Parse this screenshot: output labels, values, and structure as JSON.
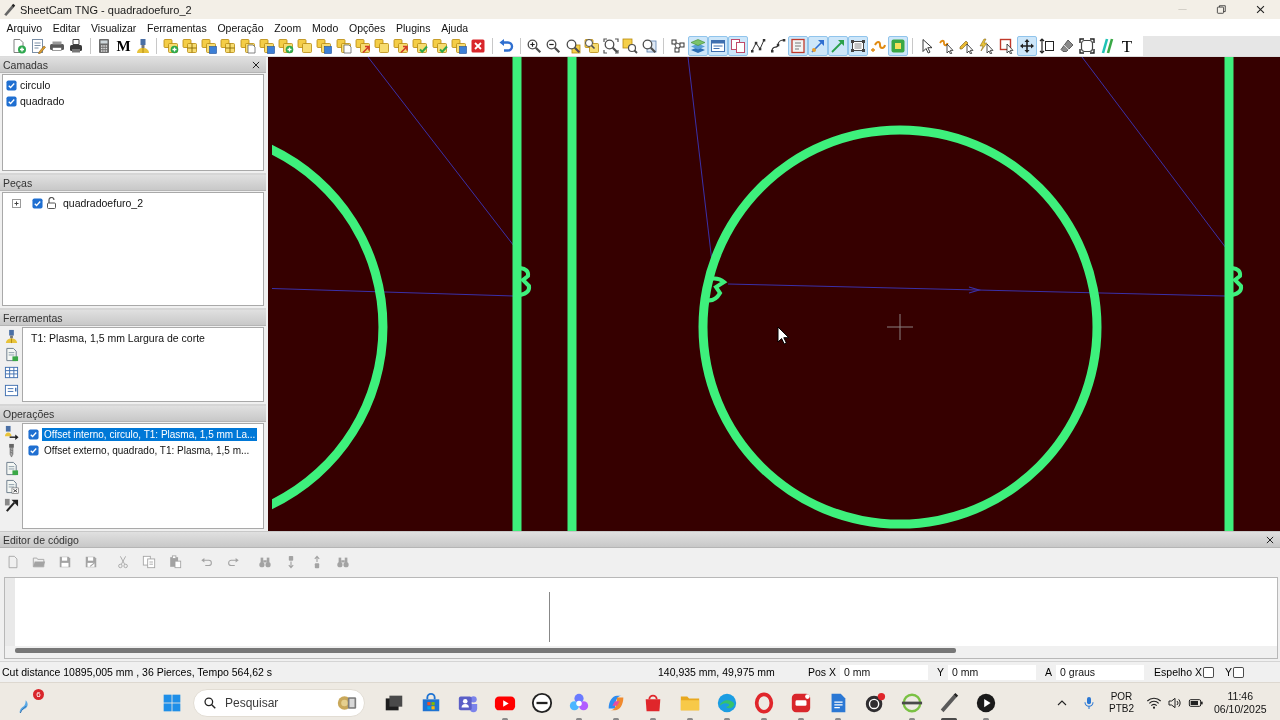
{
  "window": {
    "title": "SheetCam TNG - quadradoefuro_2"
  },
  "window_controls": [
    {
      "disabled": true
    },
    {
      "disabled": false
    },
    {
      "disabled": false
    }
  ],
  "menu": [
    "Arquivo",
    "Editar",
    "Visualizar",
    "Ferramentas",
    "Operação",
    "Zoom",
    "Modo",
    "Opções",
    "Plugins",
    "Ajuda"
  ],
  "toolbar": {
    "letter_button": "M",
    "view_toggles": [
      {
        "on": false
      },
      {
        "on": true
      },
      {
        "on": true
      },
      {
        "on": true
      },
      {
        "on": false
      },
      {
        "on": false
      },
      {
        "on": true
      },
      {
        "on": true
      },
      {
        "on": true
      },
      {
        "on": true
      },
      {
        "on": false
      },
      {
        "on": true
      }
    ],
    "mode_tools": [
      {
        "selected": false
      },
      {
        "selected": false
      },
      {
        "selected": false
      },
      {
        "selected": false
      },
      {
        "selected": false
      },
      {
        "selected": true
      },
      {
        "selected": false
      },
      {
        "selected": false
      },
      {
        "selected": false
      },
      {
        "selected": false
      },
      {
        "selected": false,
        "letter": "T"
      }
    ]
  },
  "panels": {
    "layers": {
      "title": "Camadas",
      "items": [
        {
          "label": "circulo",
          "checked": true
        },
        {
          "label": "quadrado",
          "checked": true
        }
      ]
    },
    "parts": {
      "title": "Peças",
      "items": [
        {
          "label": "quadradoefuro_2",
          "checked": true,
          "expanded": false,
          "locked": false
        }
      ]
    },
    "tools": {
      "title": "Ferramentas",
      "items": [
        {
          "label": "T1: Plasma, 1,5 mm Largura de corte"
        }
      ]
    },
    "operations": {
      "title": "Operações",
      "items": [
        {
          "label": "Offset interno, circulo, T1: Plasma, 1,5 mm La...",
          "checked": true,
          "selected": true
        },
        {
          "label": "Offset externo, quadrado, T1: Plasma, 1,5 m...",
          "checked": true,
          "selected": false
        }
      ]
    }
  },
  "code_editor": {
    "title": "Editor de código",
    "toolbar": [
      {
        "disabled": true
      },
      {
        "disabled": true
      },
      {
        "disabled": true
      },
      {
        "disabled": true
      },
      {
        "disabled": true
      },
      {
        "disabled": true
      },
      {
        "disabled": true
      },
      {
        "disabled": true
      },
      {
        "disabled": true
      },
      {
        "disabled": true
      },
      {
        "disabled": true
      },
      {
        "disabled": true
      },
      {
        "disabled": true
      }
    ]
  },
  "status_bar": {
    "summary": "Cut distance 10895,005 mm , 36 Pierces, Tempo 564,62 s",
    "cursor_position": "140,935 mm, 49,975 mm",
    "fields": [
      {
        "label": "Pos X",
        "value": "0 mm"
      },
      {
        "label": "Y",
        "value": "0 mm"
      },
      {
        "label": "A",
        "value": "0 graus"
      }
    ],
    "mirror": [
      {
        "label": "Espelho X",
        "checked": false
      },
      {
        "label": "Y",
        "checked": false
      }
    ]
  },
  "taskbar": {
    "widget_badge": "6",
    "search": {
      "placeholder": "Pesquisar"
    },
    "apps": [
      {
        "running": false,
        "active": false
      },
      {
        "running": false,
        "active": false
      },
      {
        "running": false,
        "active": false
      },
      {
        "running": true,
        "active": false
      },
      {
        "running": false,
        "active": false
      },
      {
        "running": true,
        "active": false
      },
      {
        "running": true,
        "active": false
      },
      {
        "running": true,
        "active": false
      },
      {
        "running": true,
        "active": false
      },
      {
        "running": true,
        "active": false
      },
      {
        "running": true,
        "active": false
      },
      {
        "running": true,
        "active": false
      },
      {
        "running": true,
        "active": false
      },
      {
        "running": false,
        "active": false
      },
      {
        "running": true,
        "active": false
      },
      {
        "running": true,
        "active": true
      },
      {
        "running": true,
        "active": false
      }
    ],
    "language": {
      "code": "POR",
      "layout": "PTB2"
    },
    "clock": {
      "time": "11:46",
      "date": "06/10/2025"
    }
  }
}
